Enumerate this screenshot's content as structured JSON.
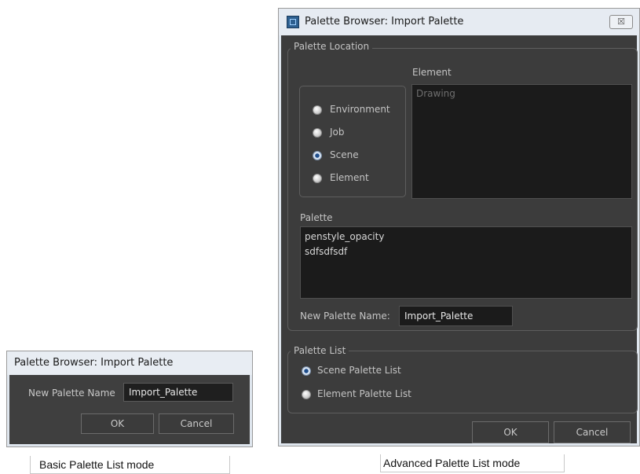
{
  "basic_dialog": {
    "title": "Palette Browser: Import Palette",
    "new_palette_label": "New Palette Name",
    "new_palette_value": "Import_Palette",
    "ok_label": "OK",
    "cancel_label": "Cancel",
    "caption": "Basic  Palette List mode"
  },
  "advanced_dialog": {
    "title": "Palette Browser: Import Palette",
    "close_glyph": "☒",
    "palette_location": {
      "legend": "Palette Location",
      "options": [
        {
          "label": "Environment",
          "selected": false
        },
        {
          "label": "Job",
          "selected": false
        },
        {
          "label": "Scene",
          "selected": true
        },
        {
          "label": "Element",
          "selected": false
        }
      ],
      "element_label": "Element",
      "element_items": [
        "Drawing"
      ],
      "palette_label": "Palette",
      "palette_items": [
        "penstyle_opacity",
        "sdfsdfsdf"
      ],
      "new_palette_label": "New Palette Name:",
      "new_palette_value": "Import_Palette"
    },
    "palette_list": {
      "legend": "Palette List",
      "options": [
        {
          "label": "Scene Palette List",
          "selected": true
        },
        {
          "label": "Element Palette List",
          "selected": false
        }
      ]
    },
    "ok_label": "OK",
    "cancel_label": "Cancel",
    "caption": "Advanced Palette List mode"
  }
}
